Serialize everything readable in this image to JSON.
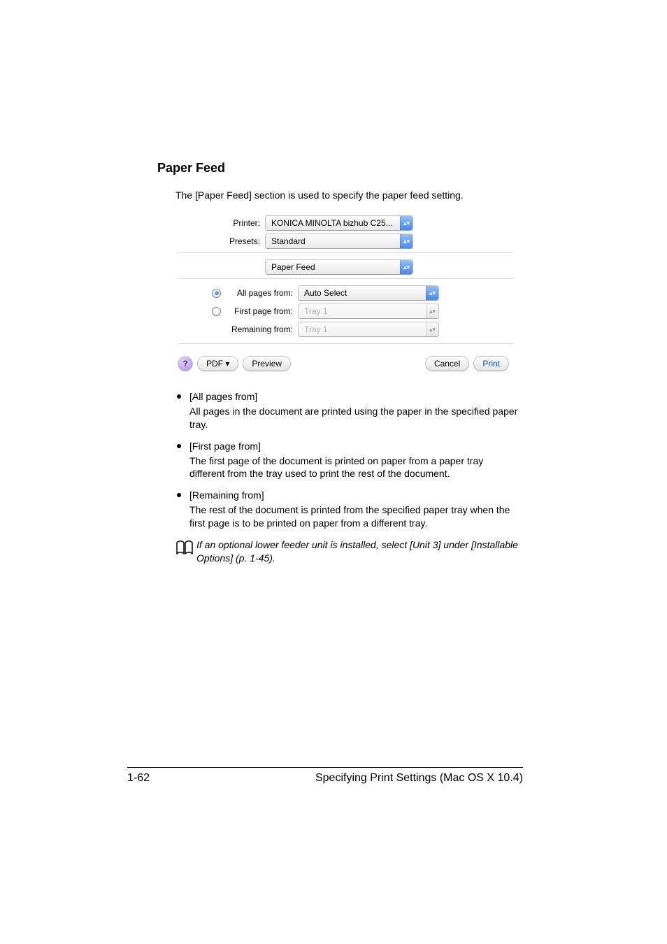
{
  "heading": "Paper Feed",
  "intro": "The [Paper Feed] section is used to specify the paper feed setting.",
  "dialog": {
    "printer_label": "Printer:",
    "printer_value": "KONICA MINOLTA bizhub C25...",
    "presets_label": "Presets:",
    "presets_value": "Standard",
    "section_value": "Paper Feed",
    "all_pages_label": "All pages from:",
    "all_pages_value": "Auto Select",
    "first_page_label": "First page from:",
    "first_page_value": "Tray 1",
    "remaining_label": "Remaining from:",
    "remaining_value": "Tray 1",
    "help_glyph": "?",
    "pdf_label": "PDF ▾",
    "preview_label": "Preview",
    "cancel_label": "Cancel",
    "print_label": "Print"
  },
  "bullets": [
    {
      "term": "[All pages from]",
      "desc": "All pages in the document are printed using the paper in the specified paper tray."
    },
    {
      "term": "[First page from]",
      "desc": "The first page of the document is printed on paper from a paper tray different from the tray used to print the rest of the document."
    },
    {
      "term": "[Remaining from]",
      "desc": "The rest of the document is printed from the specified paper tray when the first page is to be printed on paper from a different tray."
    }
  ],
  "note": "If an optional lower feeder unit is installed, select [Unit 3] under [Installable Options] (p. 1-45).",
  "footer": {
    "page": "1-62",
    "title": "Specifying Print Settings (Mac OS X 10.4)"
  },
  "glyphs": {
    "updown": "▴▾",
    "tri": "▾"
  }
}
